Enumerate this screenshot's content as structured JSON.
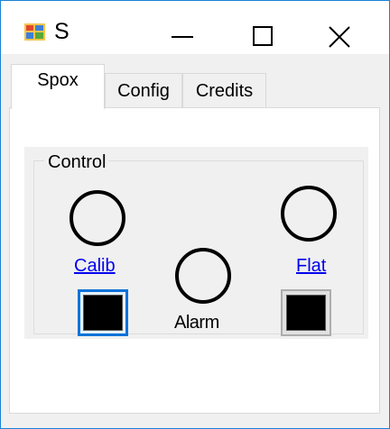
{
  "window": {
    "title": "S",
    "icon": "windows-form-icon",
    "controls": {
      "minimize_icon": "minimize-icon",
      "maximize_icon": "maximize-icon",
      "close_icon": "close-icon"
    }
  },
  "tabs": [
    {
      "label": "Spox",
      "selected": true
    },
    {
      "label": "Config",
      "selected": false
    },
    {
      "label": "Credits",
      "selected": false
    }
  ],
  "control_group": {
    "label": "Control",
    "calib_link": "Calib",
    "flat_link": "Flat",
    "alarm_label": "Alarm"
  },
  "colors": {
    "accent": "#0a73d9",
    "window_border": "#1883d7",
    "link": "#0000ee",
    "swatch": "#000000"
  }
}
